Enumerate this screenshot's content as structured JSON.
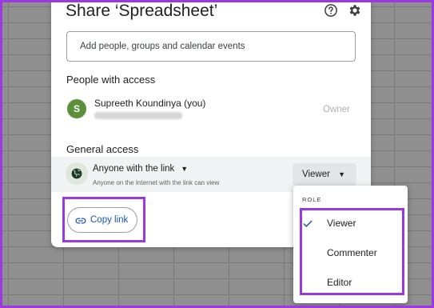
{
  "dialog": {
    "title": "Share ‘Spreadsheet’",
    "add_placeholder": "Add people, groups and calendar events"
  },
  "people_with_access": {
    "heading": "People with access",
    "person": {
      "avatar_letter": "S",
      "name": "Supreeth Koundinya (you)",
      "role": "Owner",
      "avatar_color": "#5b8f3a"
    }
  },
  "general_access": {
    "heading": "General access",
    "access_type": "Anyone with the link",
    "description": "Anyone on the Internet with the link can view",
    "role": "Viewer"
  },
  "copy_link": {
    "label": "Copy link"
  },
  "role_menu": {
    "heading": "ROLE",
    "items": [
      {
        "label": "Viewer",
        "selected": true
      },
      {
        "label": "Commenter",
        "selected": false
      },
      {
        "label": "Editor",
        "selected": false
      }
    ]
  },
  "colors": {
    "highlight": "#9b39e0",
    "link_blue": "#1a56b8"
  },
  "icons": [
    "help-icon",
    "gear-icon",
    "globe-icon",
    "link-icon",
    "check-icon",
    "chevron-down-icon"
  ]
}
